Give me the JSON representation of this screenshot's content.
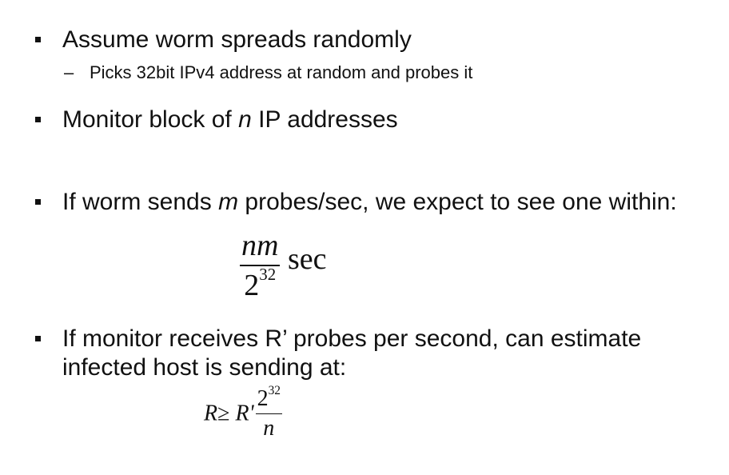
{
  "bullets": [
    {
      "text": "Assume worm spreads randomly"
    },
    {
      "pre": "Monitor block of ",
      "var": "n",
      "post": " IP addresses"
    },
    {
      "pre": "If worm sends ",
      "var": "m",
      "post": " probes/sec, we expect to see one within:"
    },
    {
      "text": "If monitor receives R’ probes per second, can estimate infected host is sending at:"
    }
  ],
  "sub_bullets": [
    {
      "dash": "–",
      "text": "Picks 32bit IPv4 address at random and probes it"
    }
  ],
  "formula1": {
    "numerator": "nm",
    "denominator_base": "2",
    "denominator_exp": "32",
    "unit": "sec"
  },
  "formula2": {
    "lhs": "R",
    "relation": "≥",
    "rhs_prefix": "R'",
    "numerator_base": "2",
    "numerator_exp": "32",
    "denominator": "n"
  }
}
